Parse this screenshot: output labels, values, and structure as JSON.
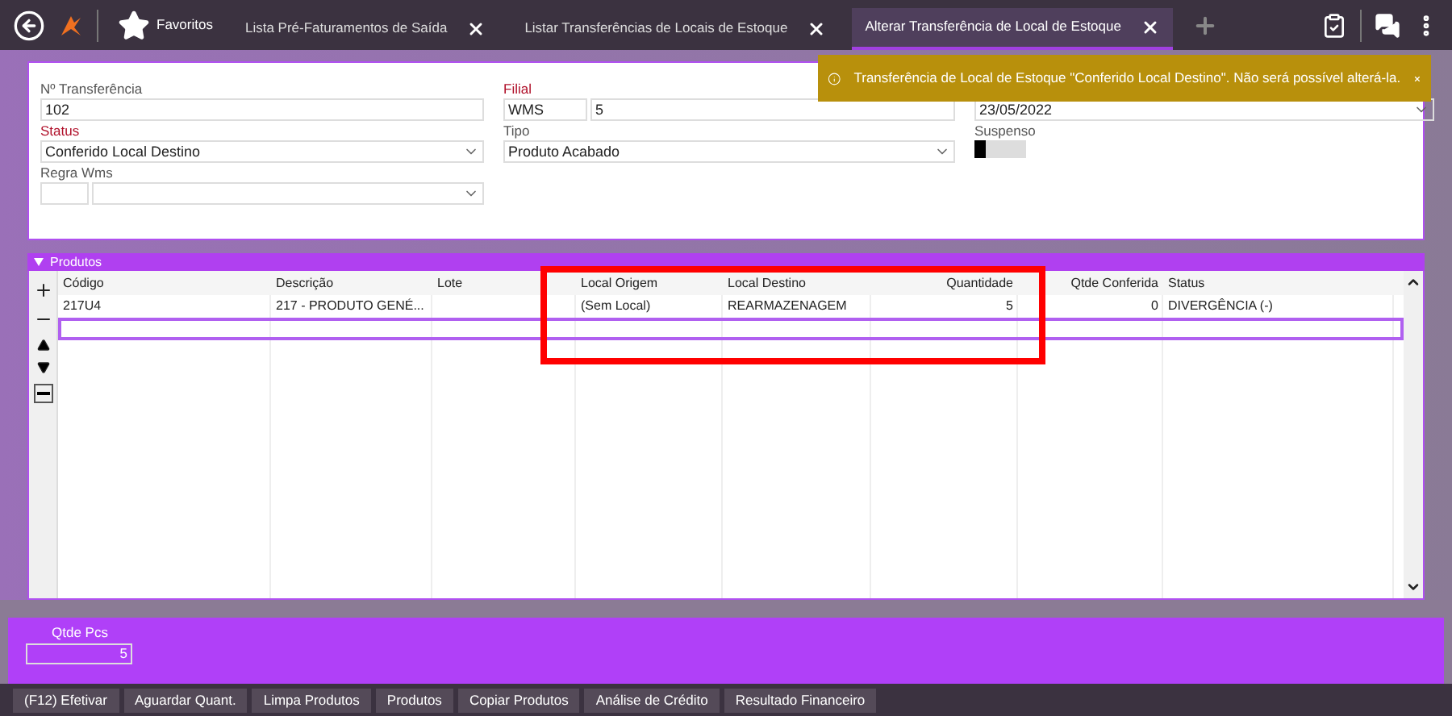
{
  "tabs": [
    {
      "label": "Favoritos",
      "kind": "favorites",
      "selected": false
    },
    {
      "label": "Lista Pré-Faturamentos de Saída",
      "kind": "tab",
      "selected": false
    },
    {
      "label": "Listar Transferências de Locais de Estoque",
      "kind": "tab",
      "selected": false
    },
    {
      "label": "Alterar Transferência de Local de Estoque",
      "kind": "tab",
      "selected": true
    }
  ],
  "toast": {
    "message": "Transferência de Local de Estoque \"Conferido Local Destino\". Não será possível alterá-la."
  },
  "form": {
    "transfer_no": {
      "label": "Nº Transferência",
      "value": "102",
      "required": false
    },
    "filial": {
      "label": "Filial",
      "code": "WMS",
      "value": "5",
      "required": true
    },
    "date": {
      "value": "23/05/2022"
    },
    "status": {
      "label": "Status",
      "value": "Conferido Local Destino",
      "required": true
    },
    "tipo": {
      "label": "Tipo",
      "value": "Produto Acabado",
      "required": false
    },
    "suspenso": {
      "label": "Suspenso",
      "on": false
    },
    "regra": {
      "label": "Regra Wms"
    }
  },
  "products": {
    "title": "Produtos",
    "expanded": true,
    "columns": [
      {
        "label": "Código",
        "kind": "text"
      },
      {
        "label": "Descrição",
        "kind": "text"
      },
      {
        "label": "Lote",
        "kind": "text"
      },
      {
        "label": "Local Origem",
        "kind": "text"
      },
      {
        "label": "Local Destino",
        "kind": "text"
      },
      {
        "label": "Quantidade",
        "kind": "number"
      },
      {
        "label": "Qtde Conferida",
        "kind": "number"
      },
      {
        "label": "Status",
        "kind": "text"
      }
    ],
    "rows": [
      {
        "cells": [
          "217U4",
          "217 - PRODUTO GENÉ...",
          "",
          "(Sem Local)",
          "REARMAZENAGEM",
          "5",
          "0",
          "DIVERGÊNCIA (-)"
        ],
        "selected": false
      },
      {
        "cells": [
          "",
          "",
          "",
          "",
          "",
          "",
          "",
          ""
        ],
        "selected": true
      }
    ]
  },
  "qtde_pcs": {
    "label": "Qtde Pcs",
    "value": "5"
  },
  "buttons": [
    "(F12) Efetivar",
    "Aguardar Quant.",
    "Limpa Produtos",
    "Produtos",
    "Copiar Produtos",
    "Análise de Crédito",
    "Resultado Financeiro"
  ]
}
